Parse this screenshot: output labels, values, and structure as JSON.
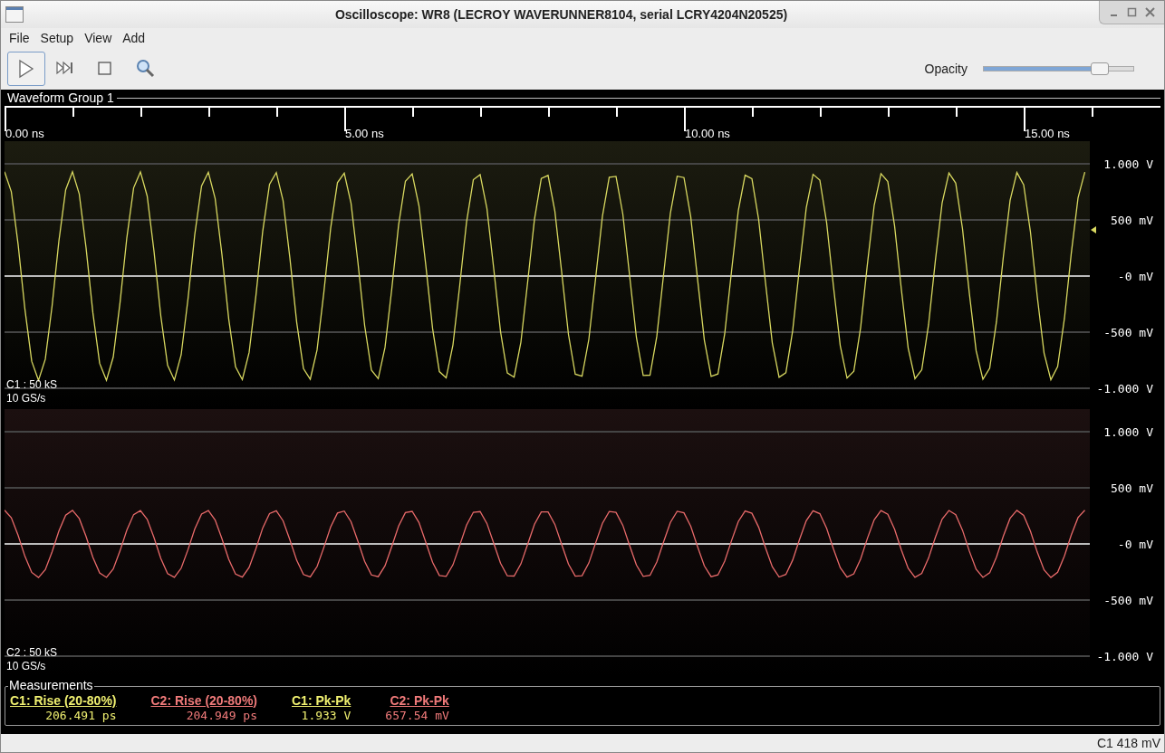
{
  "window": {
    "title": "Oscilloscope: WR8 (LECROY WAVERUNNER8104, serial LCRY4204N20525)"
  },
  "menu": [
    "File",
    "Setup",
    "View",
    "Add"
  ],
  "toolbar": [
    {
      "kind": "play",
      "selected": true
    },
    {
      "kind": "single",
      "selected": false
    },
    {
      "kind": "stop",
      "selected": false
    },
    {
      "kind": "zoom",
      "selected": false
    }
  ],
  "opacity": {
    "label": "Opacity",
    "level": 0.77
  },
  "group": {
    "title": "Waveform Group 1",
    "ruler": [
      "0.00 ns",
      "5.00 ns",
      "10.00 ns",
      "15.00 ns"
    ],
    "channels": [
      {
        "name": "C1 : 50 kS",
        "rate": "10 GS/s",
        "color": "#d8d860",
        "axis": [
          "1.000 V",
          "500 mV",
          "-0 mV",
          "-500 mV",
          "-1.000 V"
        ],
        "trigger": true
      },
      {
        "name": "C2 : 50 kS",
        "rate": "10 GS/s",
        "color": "#e86a6a",
        "axis": [
          "1.000 V",
          "500 mV",
          "-0 mV",
          "-500 mV",
          "-1.000 V"
        ],
        "trigger": false
      }
    ]
  },
  "measurements": {
    "title": "Measurements",
    "items": [
      {
        "label": "C1: Rise (20-80%)",
        "value": "206.491 ps",
        "color": "#f0f070"
      },
      {
        "label": "C2: Rise (20-80%)",
        "value": "204.949 ps",
        "color": "#f07a7a"
      },
      {
        "label": "C1: Pk-Pk",
        "value": "1.933 V",
        "color": "#f0f070"
      },
      {
        "label": "C2: Pk-Pk",
        "value": "657.54 mV",
        "color": "#f07a7a"
      }
    ]
  },
  "status_bar": "C1 418 mV"
}
